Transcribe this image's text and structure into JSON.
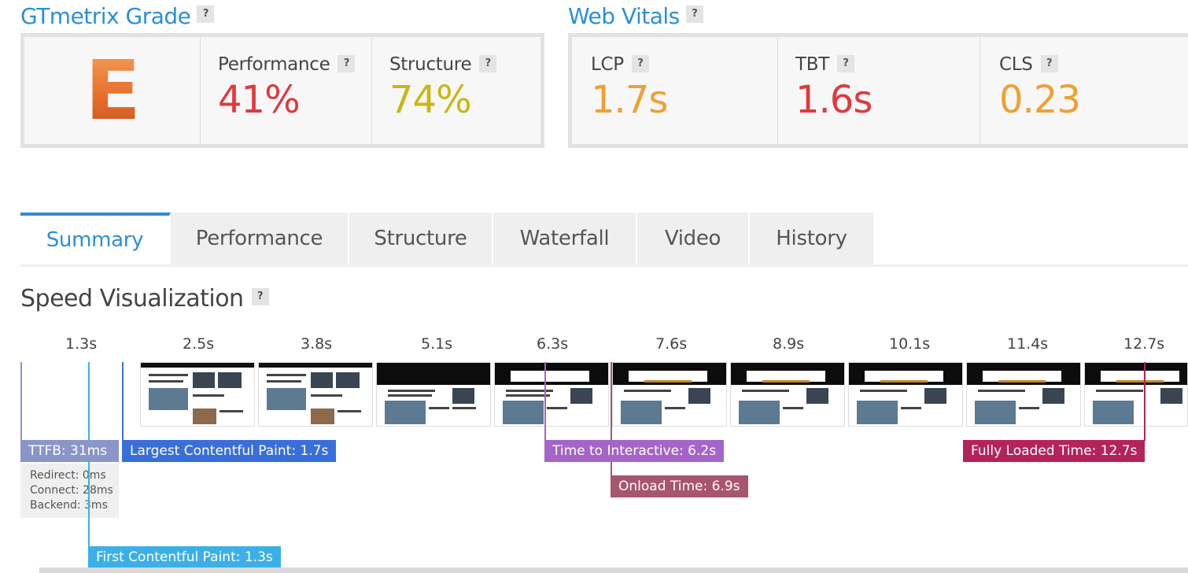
{
  "gtmetrix": {
    "title": "GTmetrix Grade",
    "help": "?",
    "grade": "E",
    "performance": {
      "label": "Performance",
      "value": "41%",
      "color": "#e0393e"
    },
    "structure": {
      "label": "Structure",
      "value": "74%",
      "color": "#c9b714"
    }
  },
  "web_vitals": {
    "title": "Web Vitals",
    "help": "?",
    "lcp": {
      "label": "LCP",
      "value": "1.7s",
      "color": "#f0a030"
    },
    "tbt": {
      "label": "TBT",
      "value": "1.6s",
      "color": "#e0393e"
    },
    "cls": {
      "label": "CLS",
      "value": "0.23",
      "color": "#f0a030"
    }
  },
  "tabs": [
    "Summary",
    "Performance",
    "Structure",
    "Waterfall",
    "Video",
    "History"
  ],
  "speed": {
    "title": "Speed Visualization",
    "help": "?",
    "times": [
      "1.3s",
      "2.5s",
      "3.8s",
      "5.1s",
      "6.3s",
      "7.6s",
      "8.9s",
      "10.1s",
      "11.4s",
      "12.7s"
    ]
  },
  "markers": {
    "ttfb": "TTFB: 31ms",
    "lcp": "Largest Contentful Paint: 1.7s",
    "tti": "Time to Interactive: 6.2s",
    "onload": "Onload Time: 6.9s",
    "fully_loaded": "Fully Loaded Time: 12.7s",
    "fcp": "First Contentful Paint: 1.3s"
  },
  "ttfb_detail": {
    "redirect": "Redirect: 0ms",
    "connect": "Connect: 28ms",
    "backend": "Backend: 3ms"
  }
}
